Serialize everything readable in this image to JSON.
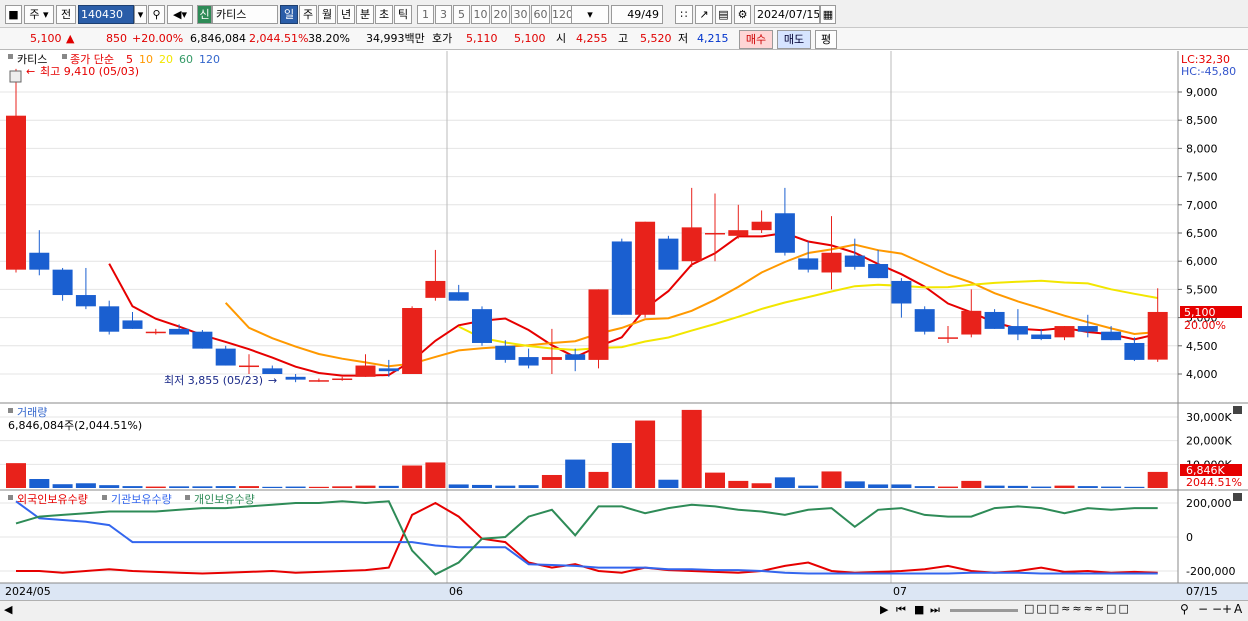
{
  "toolbar": {
    "period_select": "주",
    "prev_label": "전",
    "code": "140430",
    "market_badge": "신",
    "name": "카티스",
    "tf_buttons": [
      "일",
      "주",
      "월",
      "년",
      "분",
      "초",
      "틱"
    ],
    "tf_active": "일",
    "num_buttons": [
      "1",
      "3",
      "5",
      "10",
      "20",
      "30",
      "60",
      "120"
    ],
    "count": "49/49",
    "date": "2024/07/15"
  },
  "info": {
    "price": "5,100",
    "change": "850",
    "change_pct": "+20.00%",
    "volume": "6,846,084",
    "volume_ratio": "2,044.51%",
    "turnover": "38.20%",
    "amount": "34,993백만",
    "hoga_label": "호가",
    "ask": "5,110",
    "bid": "5,100",
    "open_label": "시",
    "open": "4,255",
    "high_label": "고",
    "high": "5,520",
    "low_label": "저",
    "low": "4,215",
    "buy_label": "매수",
    "sell_label": "매도",
    "eval_label": "평"
  },
  "price_panel": {
    "legend_name": "카티스",
    "legend_series": "종가 단순",
    "ma_periods": [
      "5",
      "10",
      "20",
      "60",
      "120"
    ],
    "ma_colors": [
      "#e60000",
      "#ff9900",
      "#f2e600",
      "#339966",
      "#3366cc"
    ],
    "lc": "LC:32,30",
    "hc": "HC:-45,80",
    "high_note": "최고 9,410 (05/03)",
    "low_note": "최저 3,855 (05/23)",
    "y_ticks": [
      "9,000",
      "8,500",
      "8,000",
      "7,500",
      "7,000",
      "6,500",
      "6,000",
      "5,500",
      "5,000",
      "4,500",
      "4,000"
    ],
    "current_tag": "5,100",
    "current_pct": "20.00%"
  },
  "volume_panel": {
    "title": "거래량",
    "info": "6,846,084주(2,044.51%)",
    "y_ticks": [
      "30,000K",
      "20,000K",
      "10,000K"
    ],
    "current_tag": "6,846K",
    "current_pct": "2044.51%"
  },
  "holdings_panel": {
    "series": [
      "외국인보유수량",
      "기관보유수량",
      "개인보유수량"
    ],
    "colors": [
      "#e60000",
      "#3366ee",
      "#2e8b57"
    ],
    "y_ticks": [
      "200,000",
      "0",
      "-200,000"
    ]
  },
  "x_axis": {
    "labels": [
      "2024/05",
      "06",
      "07",
      "07/15"
    ]
  },
  "chart_data": {
    "type": "candlestick",
    "candles": [
      {
        "o": 5850,
        "h": 9410,
        "l": 5800,
        "c": 8580,
        "v": 10.5
      },
      {
        "o": 6150,
        "h": 6550,
        "l": 5750,
        "c": 5850,
        "v": 3.8
      },
      {
        "o": 5850,
        "h": 5880,
        "l": 5300,
        "c": 5400,
        "v": 1.6
      },
      {
        "o": 5400,
        "h": 5880,
        "l": 5150,
        "c": 5200,
        "v": 2.0
      },
      {
        "o": 5200,
        "h": 5300,
        "l": 4700,
        "c": 4750,
        "v": 1.2
      },
      {
        "o": 4950,
        "h": 5100,
        "l": 4800,
        "c": 4800,
        "v": 0.8
      },
      {
        "o": 4750,
        "h": 4800,
        "l": 4700,
        "c": 4750,
        "v": 0.6
      },
      {
        "o": 4800,
        "h": 4880,
        "l": 4700,
        "c": 4700,
        "v": 0.7
      },
      {
        "o": 4750,
        "h": 4780,
        "l": 4450,
        "c": 4450,
        "v": 0.7
      },
      {
        "o": 4450,
        "h": 4500,
        "l": 4150,
        "c": 4150,
        "v": 0.8
      },
      {
        "o": 4150,
        "h": 4350,
        "l": 4000,
        "c": 4150,
        "v": 0.8
      },
      {
        "o": 4100,
        "h": 4150,
        "l": 4000,
        "c": 4000,
        "v": 0.5
      },
      {
        "o": 3950,
        "h": 4000,
        "l": 3855,
        "c": 3900,
        "v": 0.6
      },
      {
        "o": 3880,
        "h": 3920,
        "l": 3860,
        "c": 3890,
        "v": 0.5
      },
      {
        "o": 3900,
        "h": 3950,
        "l": 3880,
        "c": 3920,
        "v": 0.7
      },
      {
        "o": 3950,
        "h": 4350,
        "l": 3950,
        "c": 4150,
        "v": 1.0
      },
      {
        "o": 4100,
        "h": 4250,
        "l": 3950,
        "c": 4050,
        "v": 0.9
      },
      {
        "o": 4000,
        "h": 5200,
        "l": 4000,
        "c": 5170,
        "v": 9.5
      },
      {
        "o": 5350,
        "h": 6200,
        "l": 5300,
        "c": 5650,
        "v": 10.8
      },
      {
        "o": 5450,
        "h": 5580,
        "l": 5300,
        "c": 5300,
        "v": 1.5
      },
      {
        "o": 5150,
        "h": 5200,
        "l": 4500,
        "c": 4550,
        "v": 1.3
      },
      {
        "o": 4500,
        "h": 4600,
        "l": 4200,
        "c": 4250,
        "v": 1.0
      },
      {
        "o": 4300,
        "h": 4450,
        "l": 4100,
        "c": 4150,
        "v": 1.2
      },
      {
        "o": 4250,
        "h": 4800,
        "l": 4000,
        "c": 4300,
        "v": 5.5
      },
      {
        "o": 4350,
        "h": 4450,
        "l": 4050,
        "c": 4250,
        "v": 12.0
      },
      {
        "o": 4250,
        "h": 5500,
        "l": 4100,
        "c": 5500,
        "v": 6.8
      },
      {
        "o": 6350,
        "h": 6400,
        "l": 5050,
        "c": 5050,
        "v": 19.0
      },
      {
        "o": 5050,
        "h": 6700,
        "l": 5000,
        "c": 6700,
        "v": 28.5
      },
      {
        "o": 6400,
        "h": 6450,
        "l": 5900,
        "c": 5850,
        "v": 3.5
      },
      {
        "o": 6000,
        "h": 7300,
        "l": 5900,
        "c": 6600,
        "v": 33.0
      },
      {
        "o": 6500,
        "h": 7200,
        "l": 6000,
        "c": 6500,
        "v": 6.5
      },
      {
        "o": 6450,
        "h": 7000,
        "l": 6400,
        "c": 6550,
        "v": 3.0
      },
      {
        "o": 6550,
        "h": 6900,
        "l": 6500,
        "c": 6700,
        "v": 2.0
      },
      {
        "o": 6850,
        "h": 7300,
        "l": 6100,
        "c": 6150,
        "v": 4.5
      },
      {
        "o": 6050,
        "h": 6350,
        "l": 5800,
        "c": 5850,
        "v": 1.0
      },
      {
        "o": 5800,
        "h": 6800,
        "l": 5500,
        "c": 6150,
        "v": 7.0
      },
      {
        "o": 6100,
        "h": 6400,
        "l": 5850,
        "c": 5900,
        "v": 2.8
      },
      {
        "o": 5950,
        "h": 6200,
        "l": 5700,
        "c": 5700,
        "v": 1.5
      },
      {
        "o": 5650,
        "h": 5700,
        "l": 5000,
        "c": 5250,
        "v": 1.5
      },
      {
        "o": 5150,
        "h": 5200,
        "l": 4700,
        "c": 4750,
        "v": 0.8
      },
      {
        "o": 4650,
        "h": 4850,
        "l": 4550,
        "c": 4650,
        "v": 0.6
      },
      {
        "o": 4700,
        "h": 5500,
        "l": 4650,
        "c": 5120,
        "v": 3.0
      },
      {
        "o": 5100,
        "h": 5150,
        "l": 4800,
        "c": 4800,
        "v": 1.0
      },
      {
        "o": 4850,
        "h": 5150,
        "l": 4600,
        "c": 4700,
        "v": 0.9
      },
      {
        "o": 4700,
        "h": 4800,
        "l": 4600,
        "c": 4620,
        "v": 0.6
      },
      {
        "o": 4650,
        "h": 4850,
        "l": 4600,
        "c": 4850,
        "v": 1.0
      },
      {
        "o": 4850,
        "h": 5050,
        "l": 4650,
        "c": 4750,
        "v": 0.8
      },
      {
        "o": 4750,
        "h": 4850,
        "l": 4600,
        "c": 4600,
        "v": 0.6
      },
      {
        "o": 4550,
        "h": 4650,
        "l": 4230,
        "c": 4250,
        "v": 0.5
      },
      {
        "o": 4255,
        "h": 5520,
        "l": 4215,
        "c": 5100,
        "v": 6.8
      }
    ],
    "foreign": [
      -200,
      -200,
      -210,
      -200,
      -190,
      -200,
      -205,
      -210,
      -215,
      -210,
      -205,
      -200,
      -210,
      -205,
      -200,
      -195,
      -180,
      130,
      200,
      120,
      -10,
      -30,
      -150,
      -180,
      -160,
      -200,
      -210,
      -180,
      -195,
      -200,
      -205,
      -210,
      -200,
      -170,
      -150,
      -200,
      -210,
      -205,
      -200,
      -190,
      -170,
      -200,
      -210,
      -200,
      -180,
      -205,
      -200,
      -210,
      -205,
      -210
    ],
    "institution": [
      210,
      110,
      100,
      90,
      70,
      -30,
      -30,
      -30,
      -30,
      -30,
      -30,
      -30,
      -30,
      -30,
      -30,
      -30,
      -30,
      -30,
      -50,
      -60,
      -60,
      -60,
      -160,
      -165,
      -170,
      -180,
      -180,
      -180,
      -190,
      -190,
      -195,
      -195,
      -200,
      -210,
      -215,
      -215,
      -215,
      -215,
      -215,
      -215,
      -215,
      -210,
      -210,
      -210,
      -215,
      -215,
      -215,
      -215,
      -215,
      -215
    ],
    "individual": [
      80,
      120,
      130,
      140,
      150,
      150,
      150,
      160,
      170,
      170,
      180,
      190,
      200,
      200,
      210,
      200,
      210,
      -80,
      -220,
      -150,
      -10,
      0,
      120,
      160,
      10,
      180,
      180,
      140,
      170,
      190,
      180,
      160,
      150,
      130,
      160,
      170,
      60,
      160,
      170,
      130,
      120,
      120,
      170,
      180,
      170,
      140,
      170,
      160,
      170,
      170
    ],
    "x_labels": [
      "2024/05",
      "06",
      "07",
      "07/15"
    ],
    "ylim": [
      3700,
      9400
    ]
  }
}
